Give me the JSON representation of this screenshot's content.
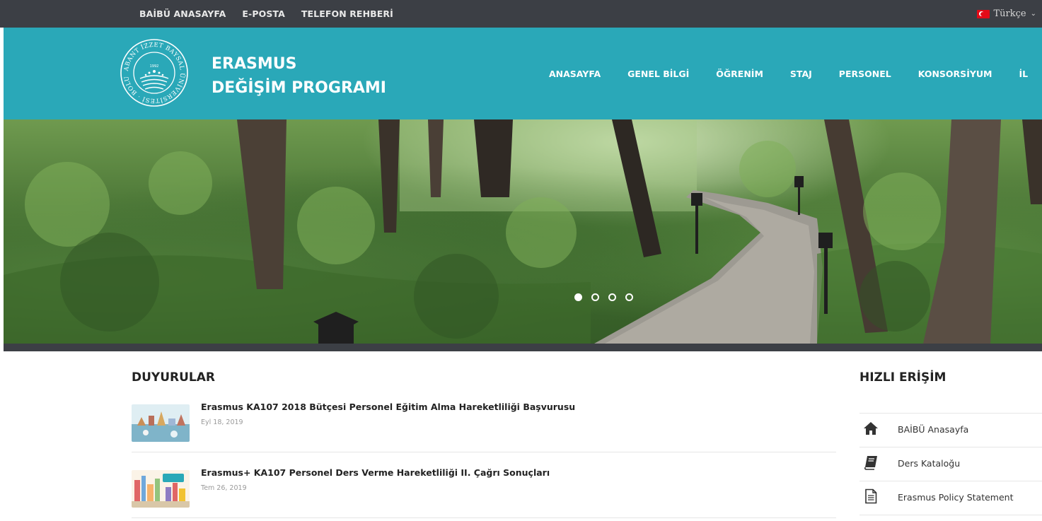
{
  "topbar": {
    "links": [
      "BAİBÜ ANASAYFA",
      "E-POSTA",
      "TELEFON REHBERİ"
    ],
    "language": "Türkçe"
  },
  "header": {
    "brand_line1": "ERASMUS",
    "brand_line2": "DEĞİŞİM PROGRAMI",
    "logo_ring_text": "ABANT İZZET BAYSAL ÜNİVERSİTESİ · BOLU",
    "logo_year": "1992",
    "nav": [
      "ANASAYFA",
      "GENEL BİLGİ",
      "ÖĞRENİM",
      "STAJ",
      "PERSONEL",
      "KONSORSİYUM",
      "İL"
    ]
  },
  "slider": {
    "slide_count": 4,
    "active_slide": 1
  },
  "announcements": {
    "title": "DUYURULAR",
    "items": [
      {
        "title": "Erasmus KA107 2018 Bütçesi Personel Eğitim Alma Hareketliliği Başvurusu",
        "date": "Eyl 18, 2019"
      },
      {
        "title": "Erasmus+ KA107 Personel Ders Verme Hareketliliği II. Çağrı Sonuçları",
        "date": "Tem 26, 2019"
      }
    ]
  },
  "quick_access": {
    "title": "HIZLI ERİŞİM",
    "items": [
      {
        "label": "BAİBÜ Anasayfa",
        "icon": "home-icon"
      },
      {
        "label": "Ders Kataloğu",
        "icon": "book-icon"
      },
      {
        "label": "Erasmus Policy Statement",
        "icon": "document-icon"
      }
    ]
  },
  "colors": {
    "topbar": "#3c3f45",
    "header": "#2aa8b8",
    "text": "#222222",
    "muted": "#9a9a9a"
  }
}
